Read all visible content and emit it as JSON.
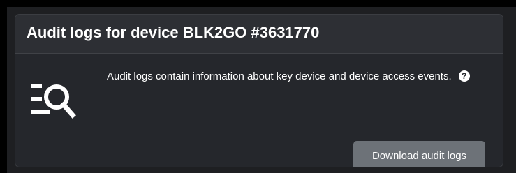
{
  "card": {
    "title": "Audit logs for device BLK2GO #3631770",
    "description": "Audit logs contain information about key device and device access events.",
    "help_icon_glyph": "?",
    "icon": "audit-log-search-icon",
    "download_label": "Download audit logs"
  },
  "colors": {
    "background": "#000000",
    "card_body": "#25272c",
    "card_header": "#2d2f34",
    "button": "#6d7278",
    "text": "#ffffff"
  }
}
